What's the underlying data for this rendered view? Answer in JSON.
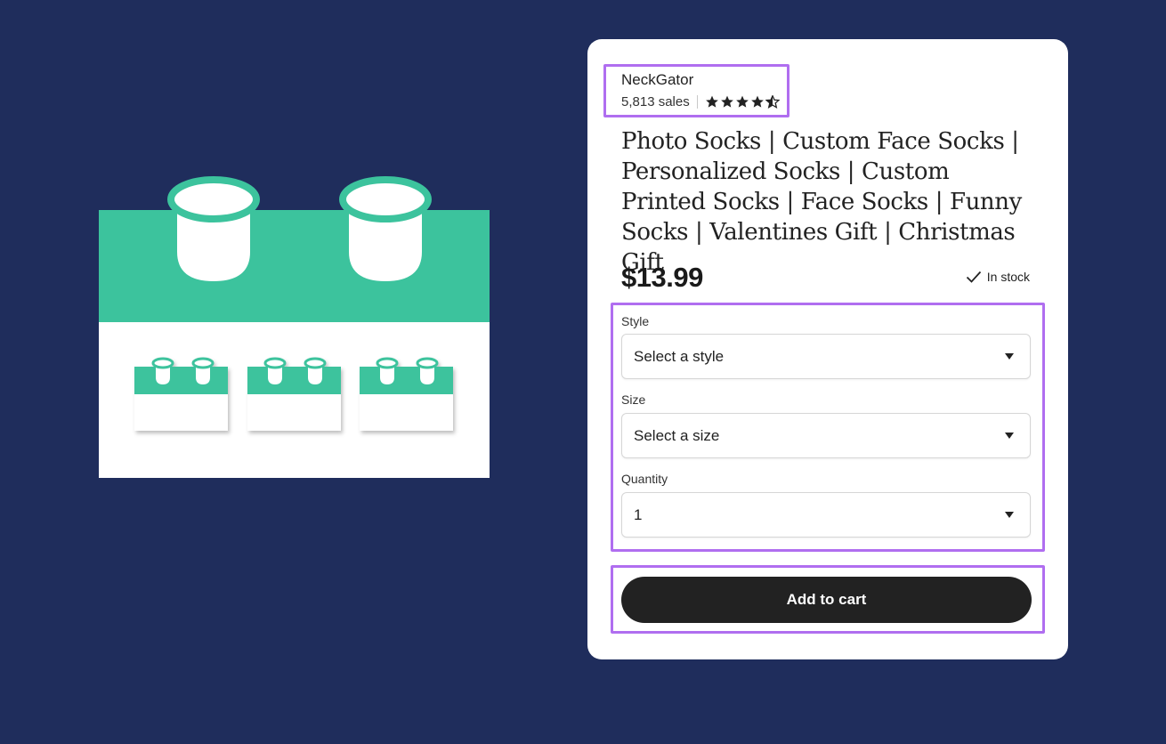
{
  "shop": {
    "name": "NeckGator",
    "sales": "5,813 sales",
    "rating": 4.5
  },
  "product": {
    "title": "Photo Socks | Custom Face Socks | Personalized Socks | Custom Printed Socks | Face Socks | Funny Socks | Valentines Gift | Christmas Gift",
    "price": "$13.99",
    "stock": "In stock"
  },
  "options": {
    "style": {
      "label": "Style",
      "value": "Select a style"
    },
    "size": {
      "label": "Size",
      "value": "Select a size"
    },
    "quantity": {
      "label": "Quantity",
      "value": "1"
    }
  },
  "cart": {
    "button_label": "Add to cart"
  },
  "colors": {
    "background": "#1f2d5c",
    "accent_green": "#3cc39d",
    "highlight": "#b06ef0",
    "button": "#222222"
  },
  "icons": [
    "star-icon",
    "check-icon",
    "caret-down-icon"
  ]
}
